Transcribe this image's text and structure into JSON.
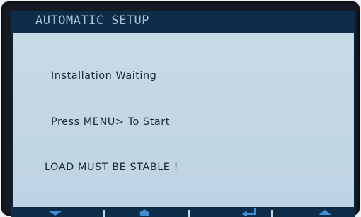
{
  "header": {
    "title": "AUTOMATIC SETUP"
  },
  "content": {
    "line1": "Installation Waiting",
    "line2": "Press MENU> To Start",
    "line3": "LOAD MUST BE STABLE !"
  },
  "softkeys": [
    {
      "icon": "arrow-down-icon"
    },
    {
      "icon": "home-icon"
    },
    {
      "icon": "enter-icon"
    },
    {
      "icon": "arrow-up-icon"
    }
  ],
  "colors": {
    "bezel": "#151a22",
    "header_bg": "#0e2d49",
    "header_text": "#a9c3dc",
    "screen_bg": "#c3d7e6",
    "text": "#1f2b34",
    "icon": "#3f8fd8"
  }
}
